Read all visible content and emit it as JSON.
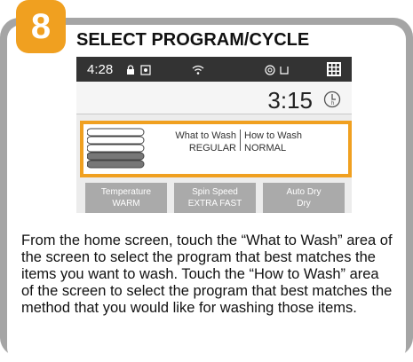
{
  "step": {
    "number": "8",
    "title": "SELECT PROGRAM/CYCLE"
  },
  "screen": {
    "status_bar": {
      "time": "4:28",
      "icons": [
        "lock-icon",
        "child-lock-icon",
        "wifi-icon",
        "drum-icon",
        "bucket-icon",
        "apps-grid-icon"
      ]
    },
    "timer": {
      "value": "3:15",
      "icon": "hours-clock-icon"
    },
    "wash_selection": {
      "what_label": "What to Wash",
      "what_value": "REGULAR",
      "how_label": "How to Wash",
      "how_value": "NORMAL"
    },
    "buttons": [
      {
        "label": "Temperature",
        "value": "WARM"
      },
      {
        "label": "Spin Speed",
        "value": "EXTRA FAST"
      },
      {
        "label": "Auto Dry",
        "value": "Dry"
      }
    ]
  },
  "description": "From the home screen, touch the “What to Wash” area of the screen to select the program that best matches the items you want to wash. Touch the “How to Wash” area of the screen to select the program that best matches the method that you would like for washing those items.",
  "colors": {
    "accent": "#f0a020",
    "frame": "#a5a5a5",
    "status_bar": "#333333",
    "button": "#aaaaaa"
  }
}
